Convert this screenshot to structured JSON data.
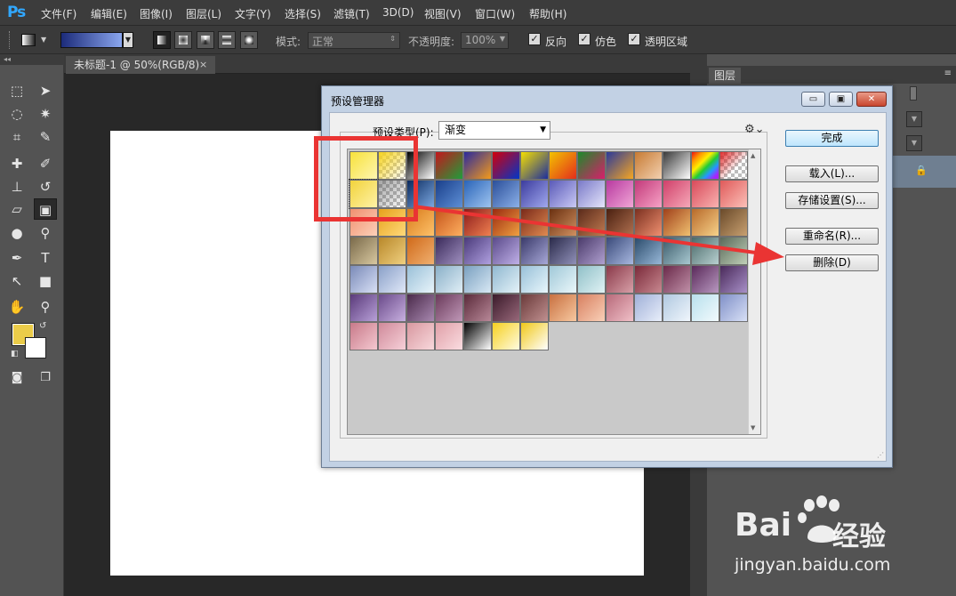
{
  "app": {
    "logo": "Ps",
    "menu": [
      "文件(F)",
      "编辑(E)",
      "图像(I)",
      "图层(L)",
      "文字(Y)",
      "选择(S)",
      "滤镜(T)",
      "3D(D)",
      "视图(V)",
      "窗口(W)",
      "帮助(H)"
    ]
  },
  "options": {
    "mode_label": "模式:",
    "mode_value": "正常",
    "opacity_label": "不透明度:",
    "opacity_value": "100%",
    "reverse_label": "反向",
    "dither_label": "仿色",
    "transparency_label": "透明区域"
  },
  "document": {
    "tab_title": "未标题-1 @ 50%(RGB/8)",
    "close_glyph": "×"
  },
  "panel": {
    "layers_tab": "图层",
    "lock_glyph": "🔒"
  },
  "colors": {
    "foreground": "#ebcc49",
    "background": "#ffffff",
    "highlight": "#ea3433"
  },
  "dialog": {
    "title": "预设管理器",
    "preset_type_label": "预设类型(P):",
    "preset_type_value": "渐变",
    "win_min": "▭",
    "win_max": "▣",
    "win_close": "✕",
    "buttons": {
      "done": "完成",
      "load": "载入(L)...",
      "save": "存储设置(S)...",
      "rename": "重命名(R)...",
      "delete": "删除(D)"
    },
    "gradients": [
      [
        "#f7e13a",
        "#fff6b0"
      ],
      [
        "#f6d320",
        "#f6d320-transparent"
      ],
      [
        "#000000",
        "#ffffff"
      ],
      [
        "#c4161c",
        "#1f9d3a"
      ],
      [
        "#2a2a9e",
        "#f39a1b"
      ],
      [
        "#d3000a",
        "#0035c8"
      ],
      [
        "#f5e000",
        "#1c2d9e"
      ],
      [
        "#f3c200",
        "#e32d1c"
      ],
      [
        "#1c8a2a",
        "#d91e6b"
      ],
      [
        "#2b3a9a",
        "#f5a623"
      ],
      [
        "#c77b33",
        "#f2d0b0"
      ],
      [
        "#3a3a3a",
        "#ffffff"
      ],
      [
        "rainbow",
        ""
      ],
      [
        "checker",
        ""
      ],
      [
        "#f1d33c",
        "#fff2a6"
      ],
      [
        "checker-soft",
        ""
      ],
      [
        "#0a2a5e",
        "#7ba7e0"
      ],
      [
        "#1a3f8a",
        "#5d8fd6"
      ],
      [
        "#2a64b8",
        "#9ec4f0"
      ],
      [
        "#2b4f9a",
        "#8bb0e8"
      ],
      [
        "#3c3c9e",
        "#a0a8ee"
      ],
      [
        "#5a5ab8",
        "#c9c9f5"
      ],
      [
        "#7a7ac8",
        "#e4e4fb"
      ],
      [
        "#b83aa0",
        "#f1a6d6"
      ],
      [
        "#c23a7a",
        "#f7a2c6"
      ],
      [
        "#d0406a",
        "#f6a8b8"
      ],
      [
        "#d84a5a",
        "#f9b2b0"
      ],
      [
        "#e05a5a",
        "#fbc0b8"
      ],
      [
        "#f09070",
        "#fcd0b8"
      ],
      [
        "#e6a21b",
        "#ffd97a"
      ],
      [
        "#d77a1a",
        "#ffc26a"
      ],
      [
        "#c4531a",
        "#ffb060"
      ],
      [
        "#8a1a1a",
        "#f08050"
      ],
      [
        "#9a2a10",
        "#f0a040"
      ],
      [
        "#7a2a1a",
        "#e08a50"
      ],
      [
        "#6a3010",
        "#d09060"
      ],
      [
        "#5a2a1a",
        "#c07a50"
      ],
      [
        "#4a2010",
        "#b07050"
      ],
      [
        "#7a3020",
        "#f09070"
      ],
      [
        "#a0401a",
        "#f0c070"
      ],
      [
        "#b86a2a",
        "#f7d28a"
      ],
      [
        "#6a4a2a",
        "#c8a070"
      ],
      [
        "#7a6a4a",
        "#d8c8a0"
      ],
      [
        "#b8882a",
        "#f0d080"
      ],
      [
        "#d06a1a",
        "#f0b070"
      ],
      [
        "#3a2a5a",
        "#a090c0"
      ],
      [
        "#4a3a7a",
        "#b0a0e0"
      ],
      [
        "#5a4a8a",
        "#c0b0e8"
      ],
      [
        "#3a3a6a",
        "#a8a8d8"
      ],
      [
        "#2a2a4a",
        "#9090b8"
      ],
      [
        "#4a3a6a",
        "#b0a0d0"
      ],
      [
        "#3a4a7a",
        "#a8b8e0"
      ],
      [
        "#2a4a6a",
        "#98b8d8"
      ],
      [
        "#3a5a6a",
        "#a8c8d0"
      ],
      [
        "#4a6a6a",
        "#b8d0d0"
      ],
      [
        "#5a6a5a",
        "#c0d0b8"
      ],
      [
        "#7a8ab8",
        "#d8e0f5"
      ],
      [
        "#8aa0c8",
        "#e0e8f8"
      ],
      [
        "#9ac0d8",
        "#e8f4fa"
      ],
      [
        "#8ab0c8",
        "#e0eef6"
      ],
      [
        "#7aa0c0",
        "#d8e8f4"
      ],
      [
        "#90b8d0",
        "#e4f2f8"
      ],
      [
        "#98c0d8",
        "#e8f6fb"
      ],
      [
        "#a0c8d8",
        "#eaf7fa"
      ],
      [
        "#90c0c8",
        "#e0f2f4"
      ],
      [
        "#8a3a4a",
        "#d8a0a8"
      ],
      [
        "#7a2a3a",
        "#c88890"
      ],
      [
        "#6a2a4a",
        "#c090a8"
      ],
      [
        "#5a2a5a",
        "#b898c0"
      ],
      [
        "#4a2a5a",
        "#a890c8"
      ],
      [
        "#5a3a7a",
        "#b8a0d8"
      ],
      [
        "#6a4a8a",
        "#c8b0e0"
      ],
      [
        "#4a2a4a",
        "#a888b0"
      ],
      [
        "#6a3a5a",
        "#c098b8"
      ],
      [
        "#5a2a3a",
        "#b88898"
      ],
      [
        "#3a1a2a",
        "#98687a"
      ],
      [
        "#6a3a3a",
        "#c09090"
      ],
      [
        "#c87040",
        "#f7c8a0"
      ],
      [
        "#d88060",
        "#f9d0b8"
      ],
      [
        "#b86a7a",
        "#f0c0c8"
      ],
      [
        "#a0b0d8",
        "#e8eefa"
      ],
      [
        "#b0c8e0",
        "#f0f6fc"
      ],
      [
        "#b8e0ec",
        "#f2fafd"
      ],
      [
        "#8090c8",
        "#d8e0f6"
      ],
      [
        "#c87a8a",
        "#f4c8d0"
      ],
      [
        "#d08a9a",
        "#f6d0d8"
      ],
      [
        "#d898a0",
        "#f8d8dc"
      ],
      [
        "#e0a0a8",
        "#fadce0"
      ],
      [
        "#000000",
        "#ffffff"
      ],
      [
        "#f5d020",
        "#fffbe0"
      ],
      [
        "#f0c818",
        "#ffffff"
      ]
    ]
  }
}
